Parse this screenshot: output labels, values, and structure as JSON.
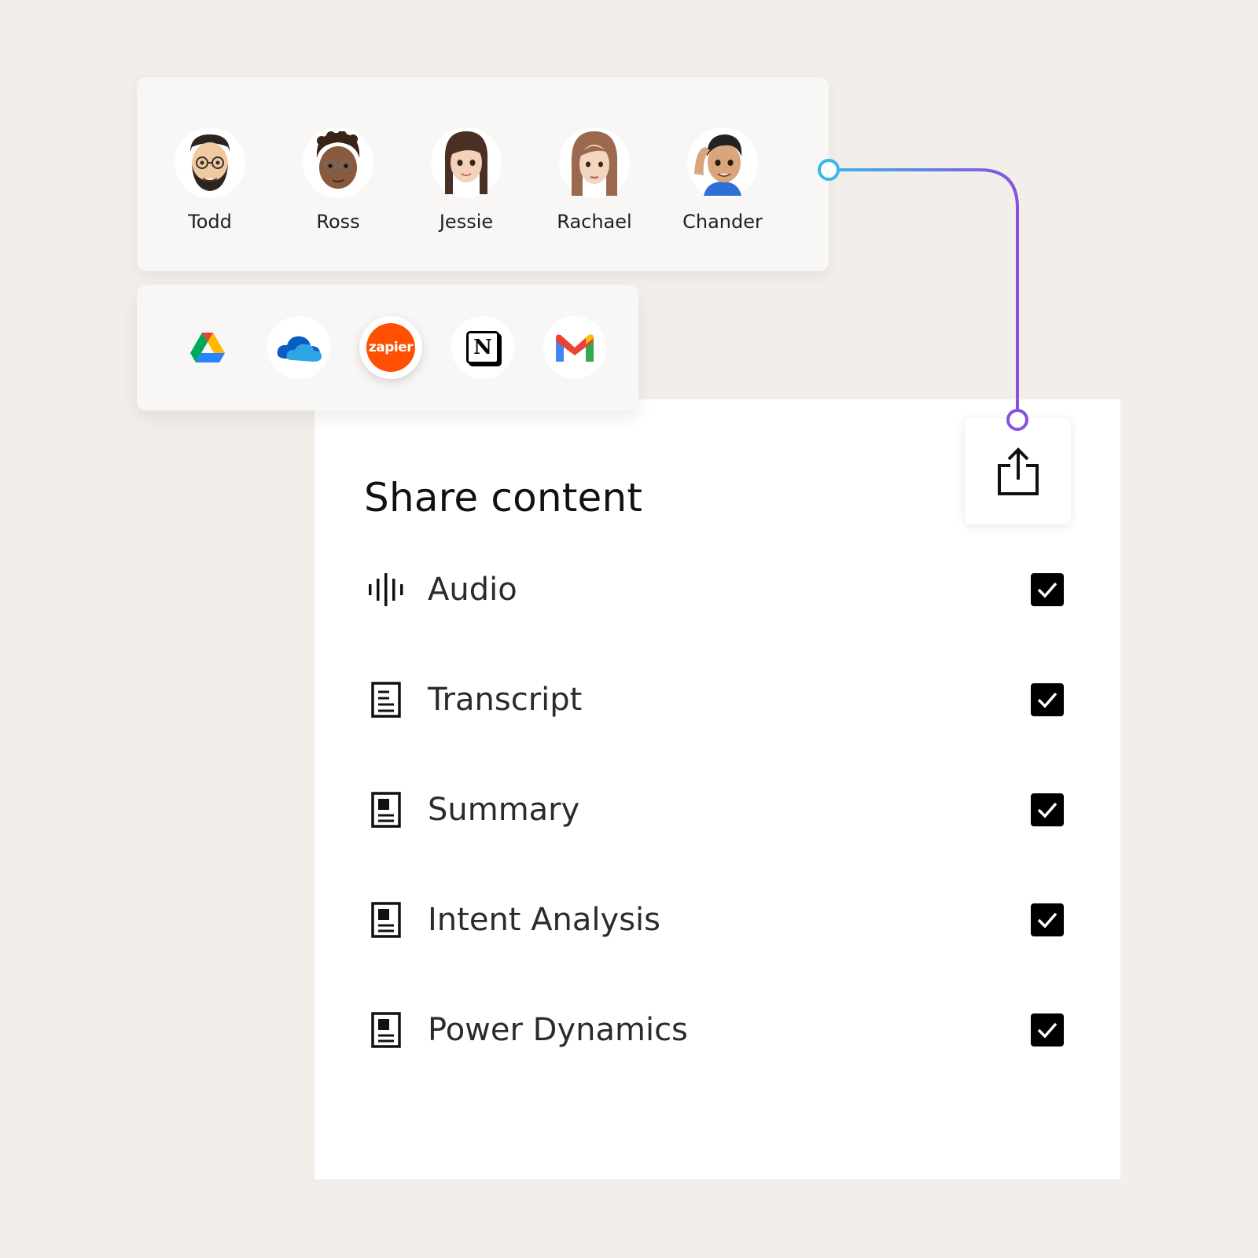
{
  "people": [
    {
      "name": "Todd",
      "skin": "#f0c9a0",
      "hair": "#2b2522"
    },
    {
      "name": "Ross",
      "skin": "#8a5a3c",
      "hair": "#3a2417"
    },
    {
      "name": "Jessie",
      "skin": "#f2d2b8",
      "hair": "#4a2f24"
    },
    {
      "name": "Rachael",
      "skin": "#f3d6c0",
      "hair": "#9b6a4e"
    },
    {
      "name": "Chander",
      "skin": "#d9a57c",
      "hair": "#222222"
    }
  ],
  "apps": [
    {
      "name": "google-drive-icon"
    },
    {
      "name": "onedrive-icon"
    },
    {
      "name": "zapier-icon",
      "label": "zapier"
    },
    {
      "name": "notion-icon",
      "label": "N"
    },
    {
      "name": "gmail-icon"
    }
  ],
  "share": {
    "title": "Share content",
    "items": [
      {
        "label": "Audio",
        "icon": "audio-waveform-icon",
        "checked": true
      },
      {
        "label": "Transcript",
        "icon": "document-icon",
        "checked": true
      },
      {
        "label": "Summary",
        "icon": "document-icon",
        "checked": true
      },
      {
        "label": "Intent Analysis",
        "icon": "document-icon",
        "checked": true
      },
      {
        "label": "Power Dynamics",
        "icon": "document-icon",
        "checked": true
      }
    ]
  },
  "colors": {
    "background": "#f2efea",
    "zapier": "#ff4f00",
    "connector_start": "#3ab8ea",
    "connector_end": "#8a4fe0"
  }
}
